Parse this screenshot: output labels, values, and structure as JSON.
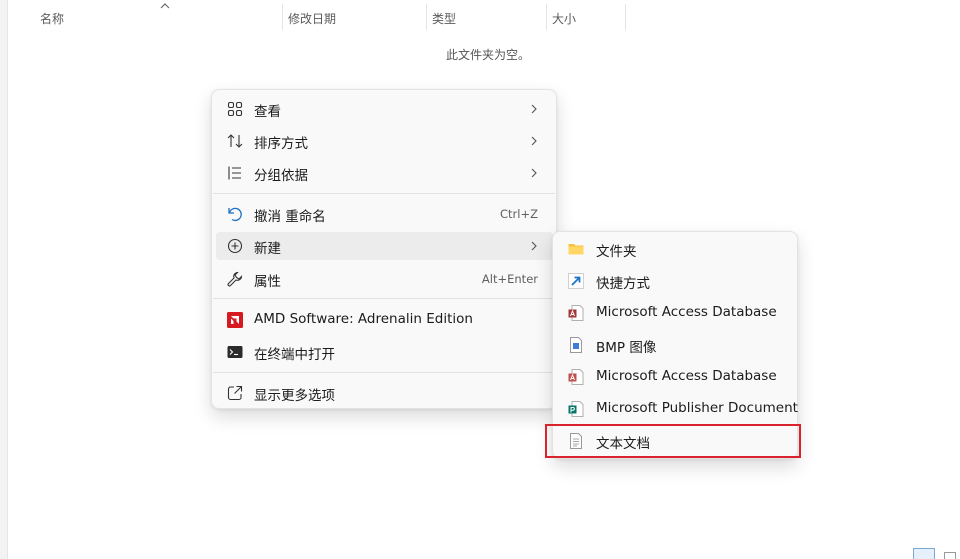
{
  "columns": {
    "name": "名称",
    "modified": "修改日期",
    "type": "类型",
    "size": "大小"
  },
  "empty_message": "此文件夹为空。",
  "context_menu": {
    "view": "查看",
    "sort_by": "排序方式",
    "group_by": "分组依据",
    "undo_rename": "撤消 重命名",
    "undo_shortcut": "Ctrl+Z",
    "new": "新建",
    "properties": "属性",
    "properties_shortcut": "Alt+Enter",
    "amd_software": "AMD Software: Adrenalin Edition",
    "open_in_terminal": "在终端中打开",
    "show_more_options": "显示更多选项"
  },
  "new_submenu": {
    "folder": "文件夹",
    "shortcut": "快捷方式",
    "access_db_1": "Microsoft Access Database",
    "bmp_image": "BMP 图像",
    "access_db_2": "Microsoft Access Database",
    "publisher_doc": "Microsoft Publisher Document",
    "text_doc": "文本文档"
  },
  "colors": {
    "accent_highlight": "#d9232d",
    "amd_red": "#d71920",
    "folder_yellow": "#f5c242",
    "shortcut_blue": "#1a73c8",
    "access_red": "#a4373a",
    "publisher_teal": "#077568"
  }
}
